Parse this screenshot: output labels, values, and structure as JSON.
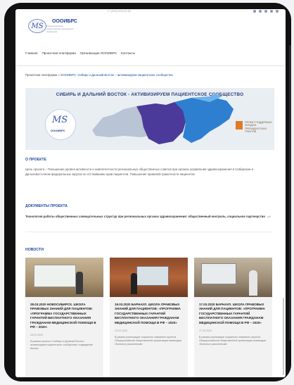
{
  "header": {
    "logo_mark": "MS",
    "logo_name": "ОООИБРС",
    "logo_sub": "Общероссийская общественная организация инвалидов",
    "phone": "+7 (000) 000-00-00"
  },
  "nav": [
    "Главная",
    "Проектная платформа",
    "Организация ОООИБРС",
    "Контакты"
  ],
  "breadcrumbs": {
    "items": [
      "Проектная платформа",
      "ОООИБРС: Сибирь и Дальний Восток – активизируем пациентское сообщество"
    ],
    "separator": "»"
  },
  "banner": {
    "title": "СИБИРЬ И ДАЛЬНИЙ ВОСТОК - АКТИВИЗИРУЕМ ПАЦИЕНТСКОЕ СООБЩЕСТВО",
    "logo_mark": "MS",
    "logo_text": "ОООИБРС",
    "grant_text": "ПРОЕКТ ПОДДЕРЖАН ФОНДОМ ПРЕЗИДЕНТСКИХ ГРАНТОВ"
  },
  "about": {
    "heading": "О ПРОЕКТЕ",
    "text": "Цель проекта – Повышение уровня активности и компетентности региональных общественных советов при органах управления здравоохранения в Сибирском и Дальневосточном федеральных округах по отстаиванию прав пациентов. Повышение правовой грамотности пациентов."
  },
  "documents": {
    "heading": "ДОКУМЕНТЫ ПРОЕКТА",
    "text": "Технология работы общественных совещательных структур при региональных органах здравоохранения: общественный контроль, социальное партнерство",
    "file_hint": "pdf"
  },
  "news": {
    "heading": "НОВОСТИ",
    "items": [
      {
        "title": "28.03.2020 НОВОСИБИРСК. ШКОЛА ПРАВОВЫХ ЗНАНИЙ ДЛЯ ПАЦИЕНТОВ: «ПРОГРАММА ГОСУДАРСТВЕННЫХ ГАРАНТИЙ БЕСПЛАТНОГО ОКАЗАНИЯ ГРАЖДАНАМ МЕДИЦИНСКОЙ ПОМОЩИ В РФ – 2020»",
        "date": "28.03.2020",
        "excerpt": "В рамках проекта «Сибирь и Дальний Восток – активизируем пациентское сообщество» подведение Школы"
      },
      {
        "title": "19.03.2020 БАРНАУЛ. ШКОЛА ПРАВОВЫХ ЗНАНИЙ ДЛЯ ПАЦИЕНТОВ: «ПРОГРАММА ГОСУДАРСТВЕННЫХ ГАРАНТИЙ БЕСПЛАТНОГО ОКАЗАНИЯ ГРАЖДАНАМ МЕДИЦИНСКОЙ ПОМОЩИ В РФ – 2020»",
        "date": "19.03.2020",
        "excerpt": "В рамках реализации социально значимого проекта Общероссийской общественной организации инвалидов «Больных рассеянным»"
      },
      {
        "title": "17.03.2020 БАРНАУЛ. ШКОЛА ПРАВОВЫХ ЗНАНИЙ ДЛЯ ПАЦИЕНТОВ: «ПРОГРАММА ГОСУДАРСТВЕННЫХ ГАРАНТИЙ БЕСПЛАТНОГО ОКАЗАНИЯ ГРАЖДАНАМ МЕДИЦИНСКОЙ ПОМОЩИ В РФ – 2020»",
        "date": "17.03.2020",
        "excerpt": "В рамках реализации социально значимого проекта Общероссийской общественной организации инвалидов «Больных рассеянным»"
      }
    ]
  },
  "colors": {
    "link": "#1e49a0",
    "heading": "#1e49a0",
    "map_purple": "#4b3a9a",
    "map_blue": "#2f7fd0",
    "grant_orange": "#e27a25"
  }
}
